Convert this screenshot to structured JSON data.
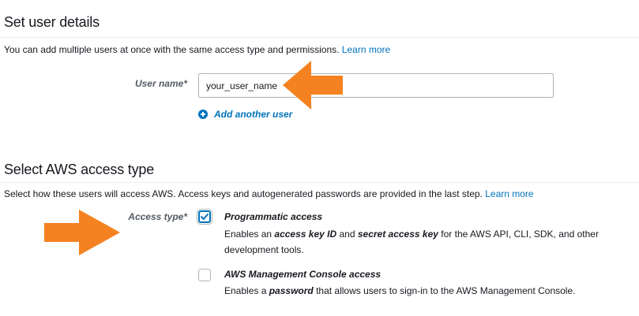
{
  "user_details": {
    "title": "Set user details",
    "description": "You can add multiple users at once with the same access type and permissions.",
    "learn_more": "Learn more",
    "username_label": "User name*",
    "username_value": "your_user_name",
    "add_user": "Add another user"
  },
  "access_type": {
    "title": "Select AWS access type",
    "description": "Select how these users will access AWS. Access keys and autogenerated passwords are provided in the last step.",
    "learn_more": "Learn more",
    "label": "Access type*",
    "options": [
      {
        "title": "Programmatic access",
        "checked": true,
        "desc_1": "Enables an",
        "desc_2": "access key ID",
        "desc_3": "and",
        "desc_4": "secret access key",
        "desc_5": "for the AWS API, CLI, SDK, and other development tools."
      },
      {
        "title": "AWS Management Console access",
        "checked": false,
        "desc_1": "Enables a",
        "desc_2": "password",
        "desc_3": "that allows users to sign-in to the AWS Management Console."
      }
    ]
  },
  "colors": {
    "link": "#0073bb",
    "arrow": "#f58220",
    "text": "#16191f",
    "label": "#545b64",
    "input_border": "#aab7b8"
  },
  "icons": [
    "plus-circle-icon",
    "check-icon",
    "arrow-left-icon",
    "arrow-right-icon"
  ]
}
